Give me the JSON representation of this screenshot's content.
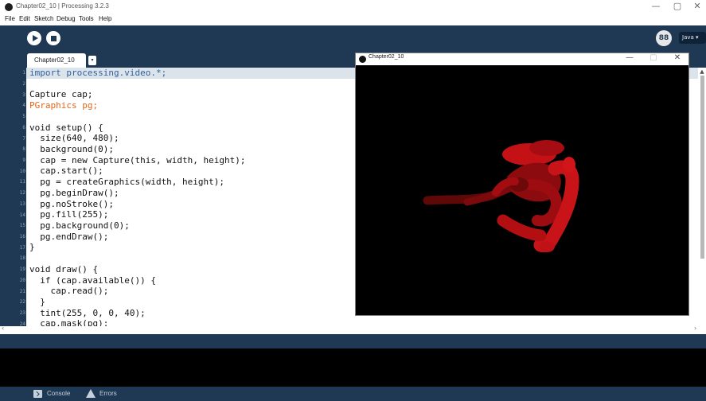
{
  "window": {
    "title": "Chapter02_10 | Processing 3.2.3",
    "minimize": "—",
    "maximize": "▢",
    "close": "✕"
  },
  "menu": [
    "File",
    "Edit",
    "Sketch",
    "Debug",
    "Tools",
    "Help"
  ],
  "toolbar": {
    "run_icon": "play-icon",
    "stop_icon": "stop-icon",
    "debugger_icon": "debugger-icon",
    "debugger_label": "88",
    "mode_label": "Java ▾"
  },
  "editor": {
    "tab_label": "Chapter02_10",
    "tab_menu": "▾",
    "line_numbers": [
      "1",
      "2",
      "3",
      "4",
      "5",
      "6",
      "7",
      "8",
      "9",
      "10",
      "11",
      "12",
      "13",
      "14",
      "15",
      "16",
      "17",
      "18",
      "19",
      "20",
      "21",
      "22",
      "23",
      "24"
    ],
    "lines": [
      "import processing.video.*;",
      "",
      "Capture cap;",
      "PGraphics pg;",
      "",
      "void setup() {",
      "  size(640, 480);",
      "  background(0);",
      "  cap = new Capture(this, width, height);",
      "  cap.start();",
      "  pg = createGraphics(width, height);",
      "  pg.beginDraw();",
      "  pg.noStroke();",
      "  pg.fill(255);",
      "  pg.background(0);",
      "  pg.endDraw();",
      "}",
      "",
      "void draw() {",
      "  if (cap.available()) {",
      "    cap.read();",
      "  }",
      "  tint(255, 0, 0, 40);",
      "  cap.mask(pg);"
    ]
  },
  "sketch_window": {
    "title": "Chapter02_10",
    "minimize": "—",
    "maximize": "▢",
    "close": "✕",
    "canvas_color": "#000000",
    "ink_color": "#b50f14"
  },
  "footer": {
    "console_label": "Console",
    "errors_label": "Errors"
  },
  "colors": {
    "chrome": "#1f3854",
    "console_bg": "#000000",
    "current_line": "#dbe4ea"
  }
}
